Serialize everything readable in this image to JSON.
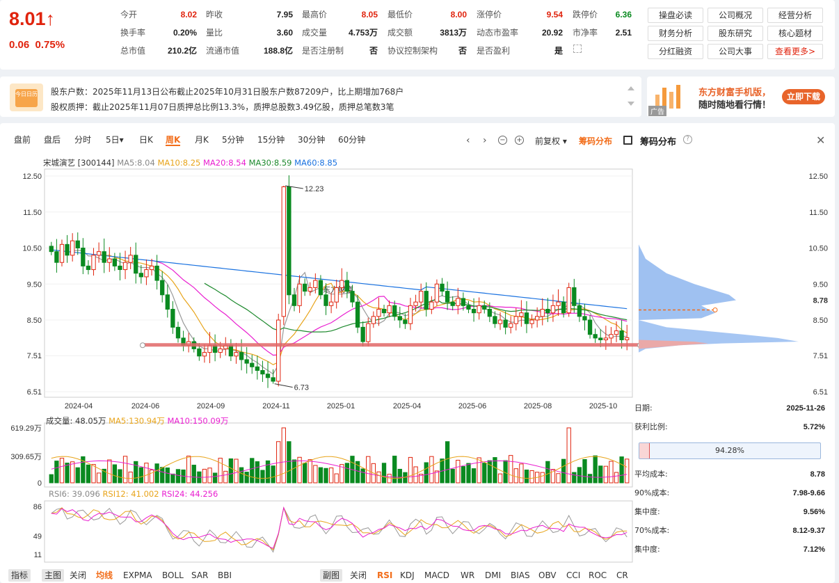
{
  "quote": {
    "price": "8.01",
    "arrow": "↑",
    "change": "0.06",
    "pct": "0.75%"
  },
  "stats": [
    {
      "label": "今开",
      "value": "8.02",
      "color": "red"
    },
    {
      "label": "昨收",
      "value": "7.95",
      "color": ""
    },
    {
      "label": "最高价",
      "value": "8.05",
      "color": "red"
    },
    {
      "label": "最低价",
      "value": "8.00",
      "color": "red"
    },
    {
      "label": "涨停价",
      "value": "9.54",
      "color": "red"
    },
    {
      "label": "跌停价",
      "value": "6.36",
      "color": "green"
    },
    {
      "label": "换手率",
      "value": "0.20%",
      "color": ""
    },
    {
      "label": "量比",
      "value": "3.60",
      "color": ""
    },
    {
      "label": "成交量",
      "value": "4.753万",
      "color": ""
    },
    {
      "label": "成交额",
      "value": "3813万",
      "color": ""
    },
    {
      "label": "动态市盈率",
      "value": "20.92",
      "color": ""
    },
    {
      "label": "市净率",
      "value": "2.51",
      "color": ""
    },
    {
      "label": "总市值",
      "value": "210.2亿",
      "color": ""
    },
    {
      "label": "流通市值",
      "value": "188.8亿",
      "color": ""
    },
    {
      "label": "是否注册制",
      "value": "否",
      "color": ""
    },
    {
      "label": "协议控制架构",
      "value": "否",
      "color": ""
    },
    {
      "label": "是否盈利",
      "value": "是",
      "color": ""
    }
  ],
  "quick_links": [
    "操盘必读",
    "公司概况",
    "经营分析",
    "财务分析",
    "股东研究",
    "核心题材",
    "分红融资",
    "公司大事",
    "查看更多>"
  ],
  "notice": {
    "icon_text": "今日日历",
    "line1": "股东户数：2025年11月13日公布截止2025年10月31日股东户数87209户，比上期增加768户",
    "line2": "股权质押：截止2025年11月07日质押总比例13.3%，质押总股数3.49亿股，质押总笔数3笔"
  },
  "ad": {
    "title": "东方财富手机版，",
    "subtitle": "随时随地看行情！",
    "button": "立即下载",
    "tag": "广告"
  },
  "toolbar": {
    "periods": [
      "盘前",
      "盘后",
      "分时",
      "5日▾",
      "日K",
      "周K",
      "月K",
      "5分钟",
      "15分钟",
      "30分钟",
      "60分钟"
    ],
    "active": "周K",
    "adjust": "前复权 ▾",
    "chips_btn": "筹码分布",
    "panel_title": "筹码分布"
  },
  "legend": {
    "name": "宋城演艺 [300144]",
    "ma5": "MA5:8.04",
    "ma10": "MA10:8.25",
    "ma20": "MA20:8.54",
    "ma30": "MA30:8.59",
    "ma60": "MA60:8.85"
  },
  "watermark": "东方财富",
  "price_axis": [
    "12.50",
    "11.50",
    "10.50",
    "9.50",
    "8.50",
    "7.51",
    "6.51"
  ],
  "x_labels": [
    "2024-04",
    "2024-06",
    "2024-09",
    "2024-11",
    "2025-01",
    "2025-04",
    "2025-06",
    "2025-08",
    "2025-10"
  ],
  "high_label": "12.23",
  "low_label": "6.73",
  "chip_avg_label": "8.78",
  "volume": {
    "legend": "成交量: 48.05万",
    "ma5": "MA5:130.94万",
    "ma10": "MA10:150.09万",
    "axis": [
      "619.29万",
      "309.65万",
      "0"
    ]
  },
  "rsi": {
    "rsi6": "RSI6: 39.096",
    "rsi12": "RSI12: 41.002",
    "rsi24": "RSI24: 44.256",
    "axis": [
      "86",
      "49",
      "11"
    ]
  },
  "chips_panel": [
    {
      "label": "日期:",
      "value": "2025-11-26"
    },
    {
      "label": "获利比例:",
      "value": "5.72%"
    },
    {
      "label": "平均成本:",
      "value": "8.78"
    },
    {
      "label": "90%成本:",
      "value": "7.98-9.66"
    },
    {
      "label": "集中度:",
      "value": "9.56%"
    },
    {
      "label": "70%成本:",
      "value": "8.12-9.37"
    },
    {
      "label": "集中度:",
      "value": "7.12%"
    }
  ],
  "profit_bar": {
    "text": "94.28%",
    "profit_fraction": 0.0572
  },
  "bottom_left": [
    "指标",
    "主图",
    "关闭",
    "均线",
    "EXPMA",
    "BOLL",
    "SAR",
    "BBI"
  ],
  "bottom_right": [
    "副图",
    "关闭",
    "RSI",
    "KDJ",
    "MACD",
    "WR",
    "DMI",
    "BIAS",
    "OBV",
    "CCI",
    "ROC",
    "CR"
  ],
  "chart_data": {
    "type": "candlestick",
    "ylim": [
      6.51,
      12.5
    ],
    "closes": [
      10.4,
      10.1,
      10.6,
      10.3,
      10.7,
      10.5,
      10.0,
      9.9,
      10.3,
      10.4,
      10.1,
      10.2,
      10.0,
      9.9,
      10.1,
      10.3,
      9.8,
      9.7,
      9.9,
      10.0,
      9.6,
      9.2,
      8.8,
      8.3,
      8.0,
      7.8,
      7.9,
      7.7,
      7.5,
      7.6,
      7.8,
      7.6,
      7.7,
      7.8,
      7.5,
      7.6,
      7.4,
      7.3,
      7.2,
      7.1,
      7.0,
      6.9,
      6.8,
      8.5,
      12.2,
      9.2,
      8.9,
      9.5,
      9.3,
      9.4,
      9.6,
      9.2,
      8.9,
      9.0,
      9.4,
      9.6,
      9.3,
      9.0,
      8.3,
      7.9,
      8.4,
      8.6,
      8.8,
      8.7,
      8.9,
      8.6,
      8.5,
      8.4,
      8.9,
      9.0,
      9.3,
      8.8,
      9.0,
      9.5,
      9.3,
      9.0,
      8.9,
      9.1,
      8.9,
      8.8,
      8.7,
      8.9,
      8.8,
      8.6,
      8.4,
      8.5,
      8.3,
      8.4,
      8.6,
      8.7,
      8.4,
      8.5,
      8.6,
      8.8,
      8.7,
      8.9,
      9.0,
      8.7,
      9.4,
      8.9,
      8.6,
      8.5,
      8.1,
      8.0,
      7.95,
      8.0,
      8.1,
      8.2,
      7.95,
      8.01
    ]
  }
}
